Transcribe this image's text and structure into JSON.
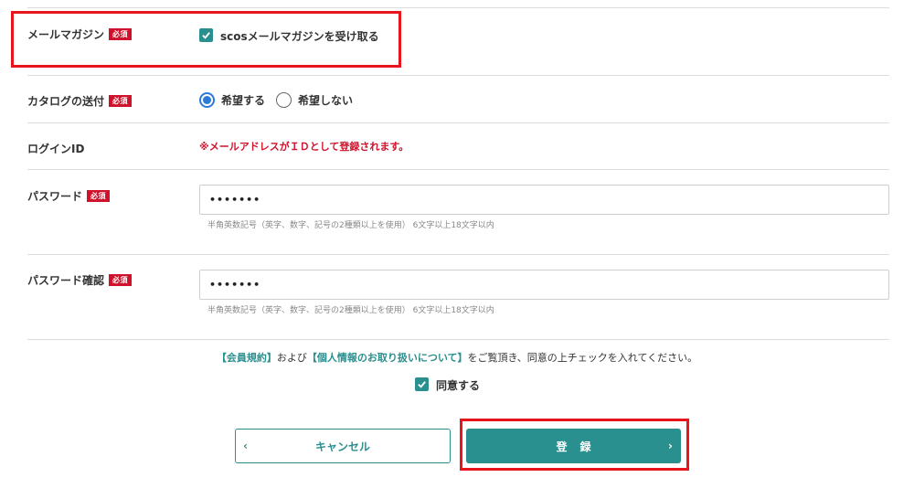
{
  "required_badge": "必須",
  "mail_magazine": {
    "label": "メールマガジン",
    "option": "scosメールマガジンを受け取る",
    "checked": true
  },
  "catalog": {
    "label": "カタログの送付",
    "option_yes": "希望する",
    "option_no": "希望しない",
    "selected": "希望する"
  },
  "login_id": {
    "label": "ログインID",
    "note": "※メールアドレスがＩＤとして登録されます。"
  },
  "password": {
    "label": "パスワード",
    "value": "•••••••",
    "hint": "半角英数記号（英字、数字、記号の2種類以上を使用） 6文字以上18文字以内"
  },
  "password_confirm": {
    "label": "パスワード確認",
    "value": "•••••••",
    "hint": "半角英数記号（英字、数字、記号の2種類以上を使用） 6文字以上18文字以内"
  },
  "consent": {
    "terms_link": "【会員規約】",
    "and": "および",
    "privacy_link": "【個人情報のお取り扱いについて】",
    "rest": "をご覧頂き、同意の上チェックを入れてください。",
    "agree_label": "同意する",
    "agree_checked": true
  },
  "buttons": {
    "cancel": "キャンセル",
    "register": "登録"
  },
  "colors": {
    "accent": "#2a8f8f",
    "required": "#d0112b",
    "highlight": "#e8141e",
    "radio_selected": "#2d7bd4"
  },
  "icons": {
    "check": "check-icon",
    "cancel_chevron": "chevron-left-icon",
    "register_chevron": "chevron-right-icon"
  }
}
